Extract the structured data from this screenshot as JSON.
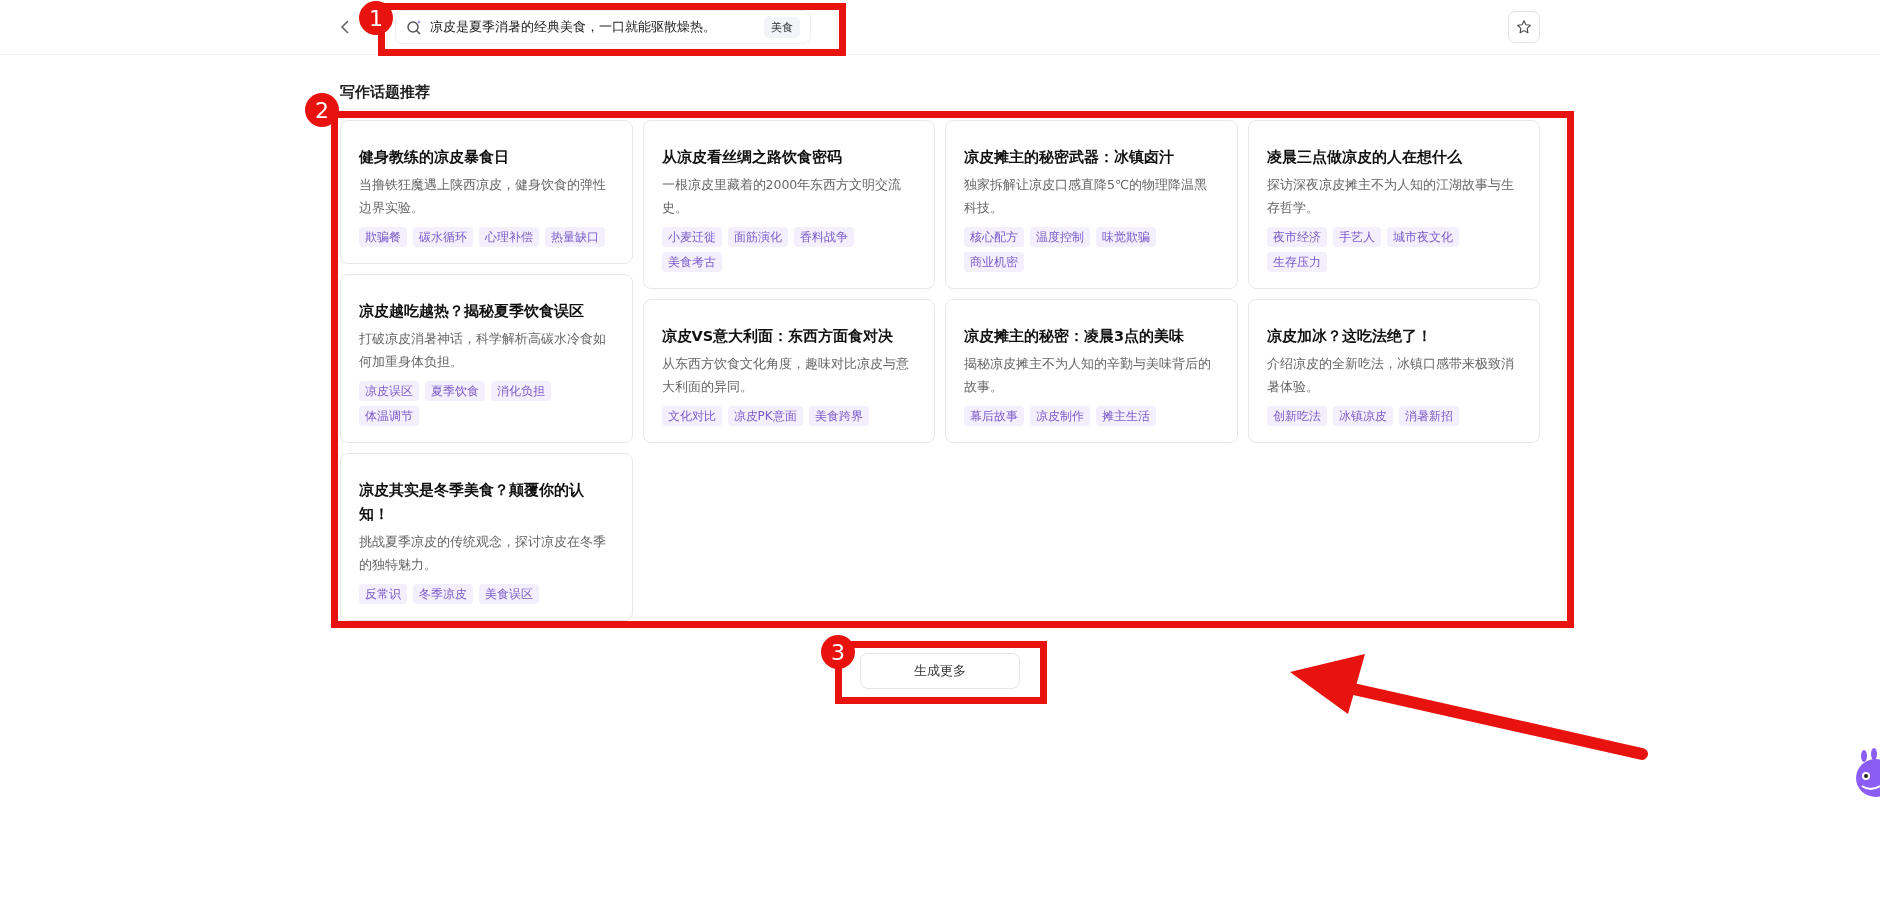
{
  "header": {
    "query": "凉皮是夏季消暑的经典美食，一口就能驱散燥热。",
    "query_tag": "美食"
  },
  "section_title": "写作话题推荐",
  "topics": [
    {
      "title": "健身教练的凉皮暴食日",
      "desc": "当撸铁狂魔遇上陕西凉皮，健身饮食的弹性边界实验。",
      "tags": [
        "欺骗餐",
        "碳水循环",
        "心理补偿",
        "热量缺口"
      ]
    },
    {
      "title": "从凉皮看丝绸之路饮食密码",
      "desc": "一根凉皮里藏着的2000年东西方文明交流史。",
      "tags": [
        "小麦迁徙",
        "面筋演化",
        "香料战争",
        "美食考古"
      ]
    },
    {
      "title": "凉皮摊主的秘密武器：冰镇卤汁",
      "desc": "独家拆解让凉皮口感直降5℃的物理降温黑科技。",
      "tags": [
        "核心配方",
        "温度控制",
        "味觉欺骗",
        "商业机密"
      ]
    },
    {
      "title": "凌晨三点做凉皮的人在想什么",
      "desc": "探访深夜凉皮摊主不为人知的江湖故事与生存哲学。",
      "tags": [
        "夜市经济",
        "手艺人",
        "城市夜文化",
        "生存压力"
      ]
    },
    {
      "title": "凉皮越吃越热？揭秘夏季饮食误区",
      "desc": "打破凉皮消暑神话，科学解析高碳水冷食如何加重身体负担。",
      "tags": [
        "凉皮误区",
        "夏季饮食",
        "消化负担",
        "体温调节"
      ]
    },
    {
      "title": "凉皮VS意大利面：东西方面食对决",
      "desc": "从东西方饮食文化角度，趣味对比凉皮与意大利面的异同。",
      "tags": [
        "文化对比",
        "凉皮PK意面",
        "美食跨界"
      ]
    },
    {
      "title": "凉皮摊主的秘密：凌晨3点的美味",
      "desc": "揭秘凉皮摊主不为人知的辛勤与美味背后的故事。",
      "tags": [
        "幕后故事",
        "凉皮制作",
        "摊主生活"
      ]
    },
    {
      "title": "凉皮加冰？这吃法绝了！",
      "desc": "介绍凉皮的全新吃法，冰镇口感带来极致消暑体验。",
      "tags": [
        "创新吃法",
        "冰镇凉皮",
        "消暑新招"
      ]
    },
    {
      "title": "凉皮其实是冬季美食？颠覆你的认知！",
      "desc": "挑战夏季凉皮的传统观念，探讨凉皮在冬季的独特魅力。",
      "tags": [
        "反常识",
        "冬季凉皮",
        "美食误区"
      ]
    }
  ],
  "more_button": "生成更多",
  "annotations": [
    {
      "label": "1"
    },
    {
      "label": "2"
    },
    {
      "label": "3"
    }
  ]
}
